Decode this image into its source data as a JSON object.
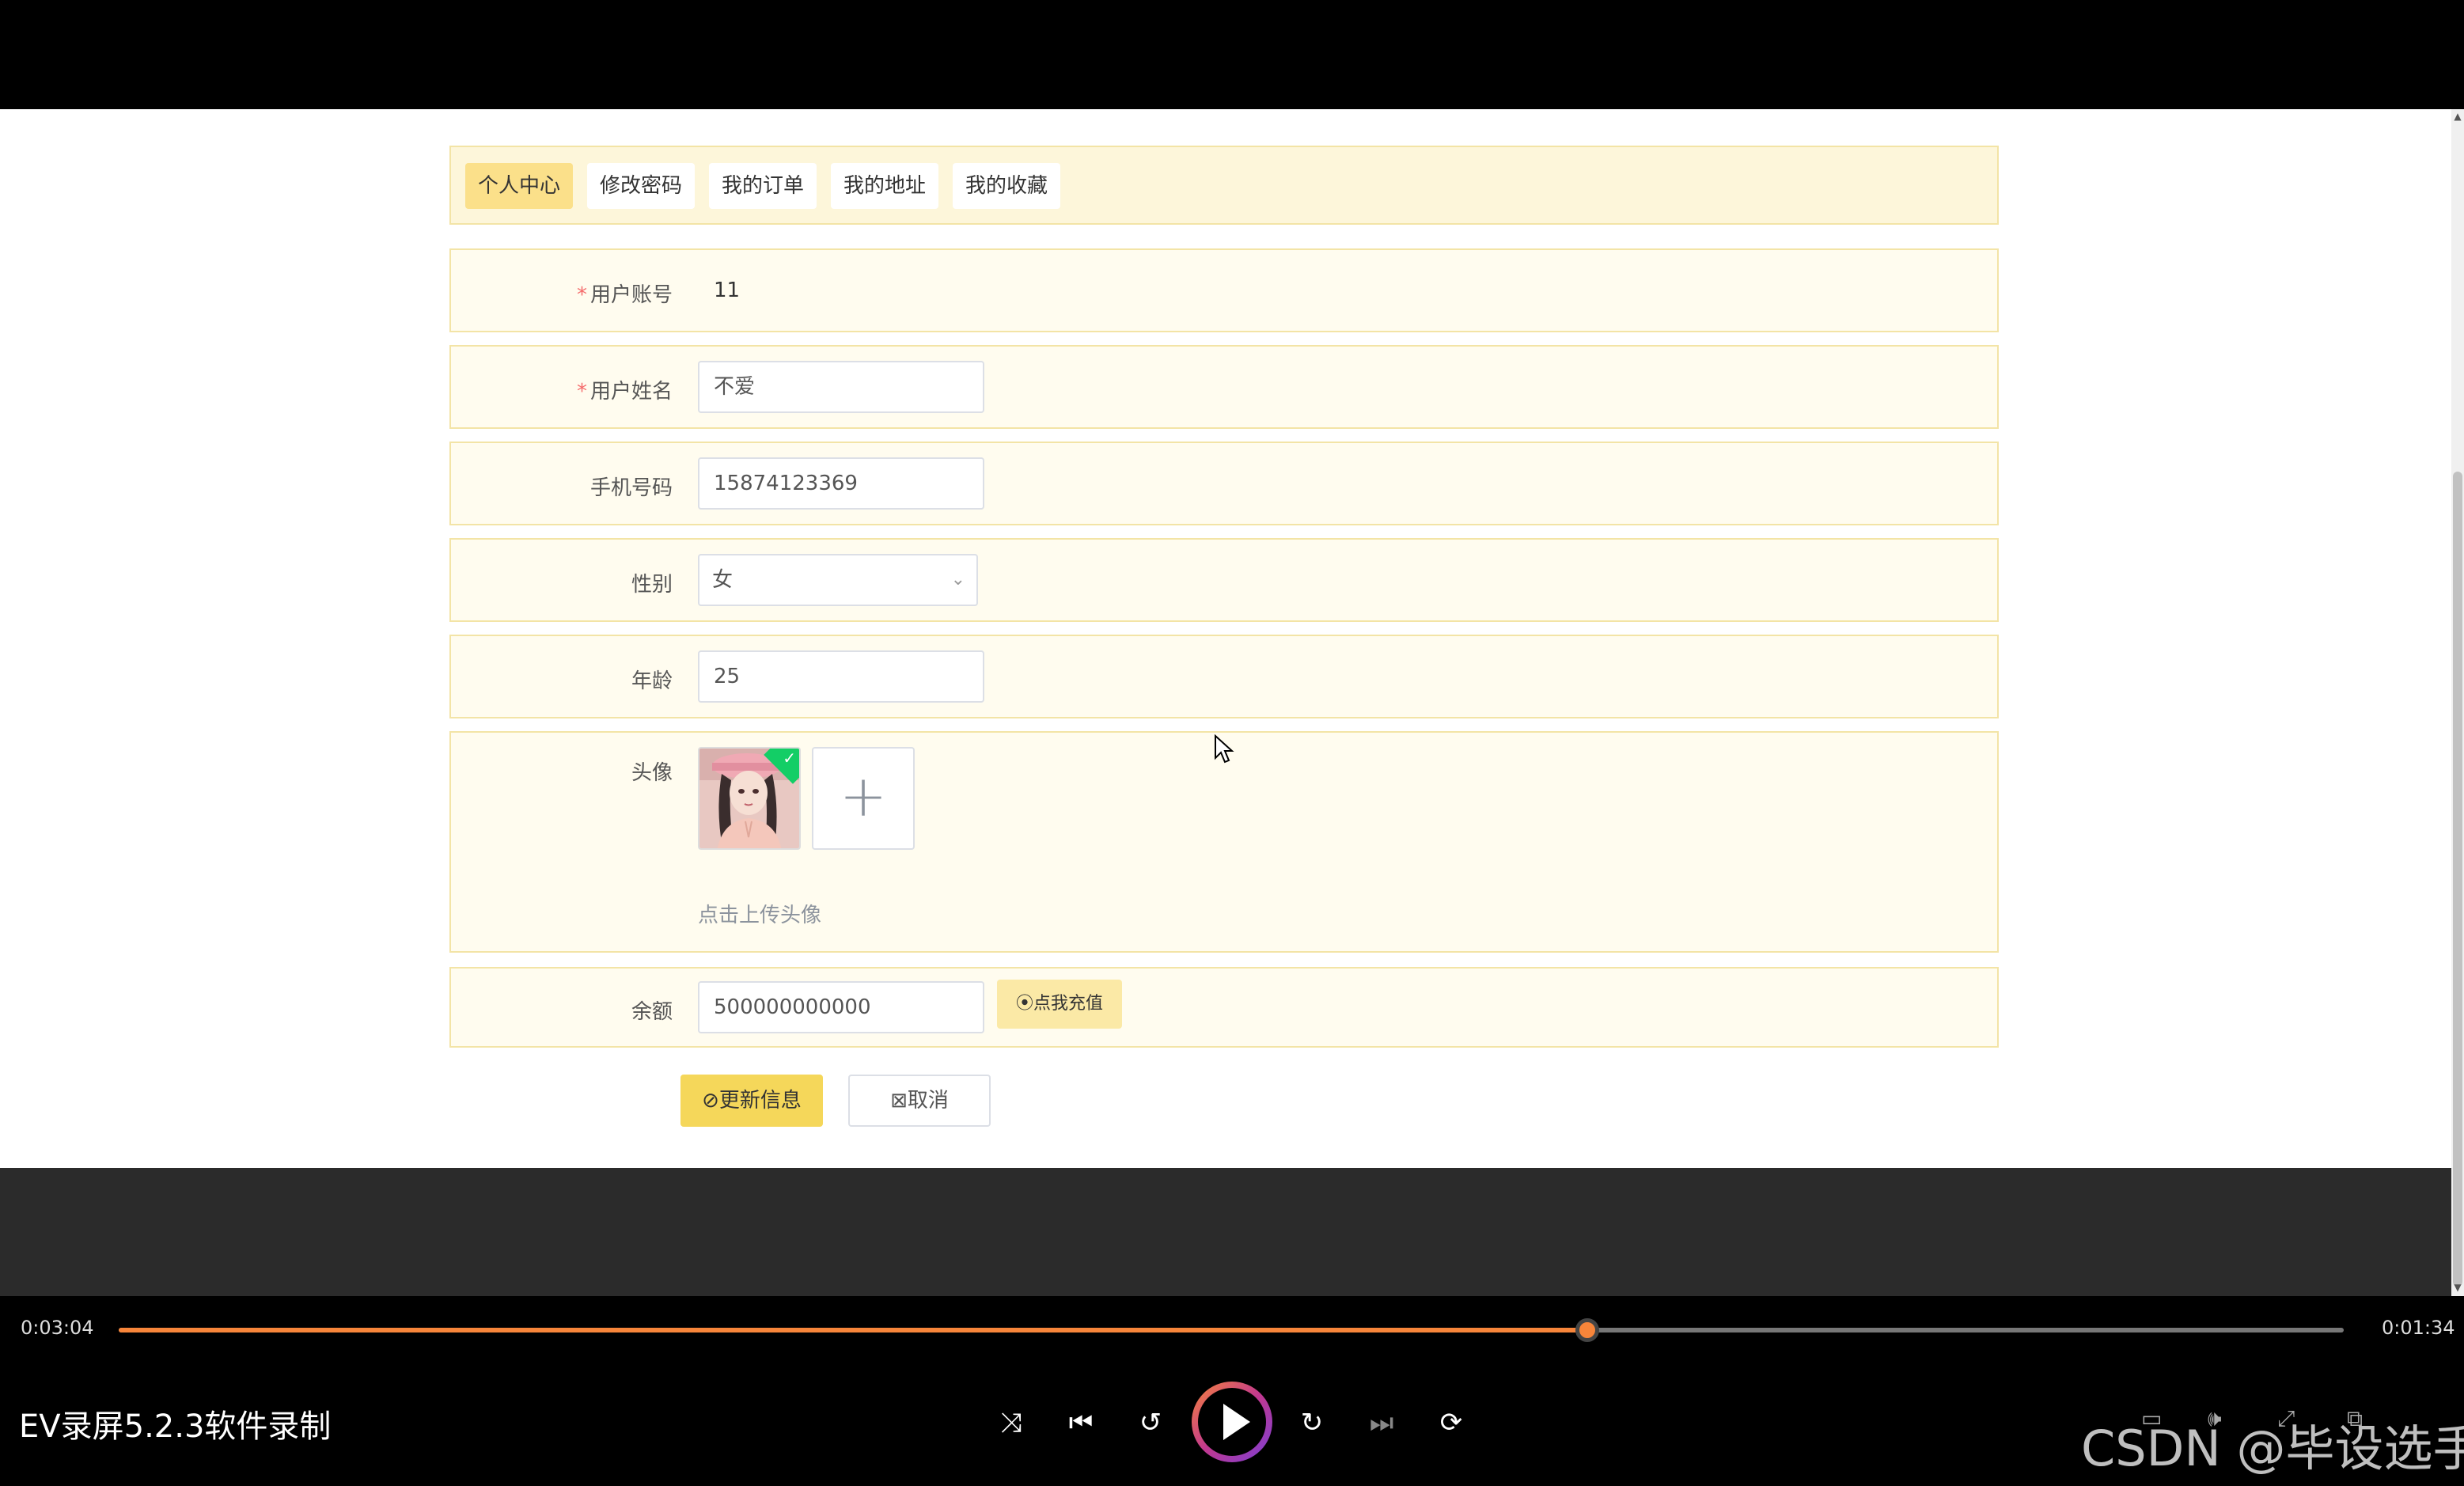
{
  "tabs": [
    "个人中心",
    "修改密码",
    "我的订单",
    "我的地址",
    "我的收藏"
  ],
  "form": {
    "account_label": "用户账号",
    "account_value": "11",
    "name_label": "用户姓名",
    "name_value": "不爱",
    "phone_label": "手机号码",
    "phone_value": "15874123369",
    "gender_label": "性别",
    "gender_value": "女",
    "age_label": "年龄",
    "age_value": "25",
    "avatar_label": "头像",
    "upload_hint": "点击上传头像",
    "balance_label": "余额",
    "balance_value": "500000000000",
    "recharge_label": "点我充值",
    "update_label": "更新信息",
    "cancel_label": "取消",
    "required_mark": "*"
  },
  "player": {
    "current_time": "0:03:04",
    "total_time": "0:01:34",
    "progress": 0.66,
    "app_label": "EV录屏5.2.3软件录制",
    "watermark": "CSDN @毕设选手",
    "accent_color": "#f7853a"
  }
}
